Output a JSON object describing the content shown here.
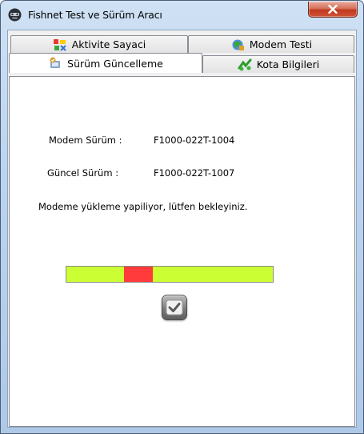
{
  "window": {
    "title": "Fishnet Test ve Sürüm Aracı",
    "close_glyph": "✕"
  },
  "tabs": {
    "row_top": [
      {
        "label": "Aktivite Sayaci",
        "icon": "activity-counter-icon"
      },
      {
        "label": "Modem Testi",
        "icon": "modem-test-icon"
      }
    ],
    "row_bottom": [
      {
        "label": "Sürüm Güncelleme",
        "icon": "version-update-icon",
        "active": true
      },
      {
        "label": "Kota Bilgileri",
        "icon": "quota-info-icon"
      }
    ]
  },
  "update_panel": {
    "modem_version_label": "Modem Sürüm :",
    "modem_version_value": "F1000-022T-1004",
    "current_version_label": "Güncel Sürüm :",
    "current_version_value": "F1000-022T-1007",
    "status_message": "Modeme yükleme yapiliyor, lütfen bekleyiniz.",
    "progress": {
      "indicator_start": 0.28,
      "indicator_end": 0.42,
      "track_color": "#ccff33",
      "indicator_color": "#ff3b3b"
    },
    "confirm_icon": "checkmark-icon"
  }
}
